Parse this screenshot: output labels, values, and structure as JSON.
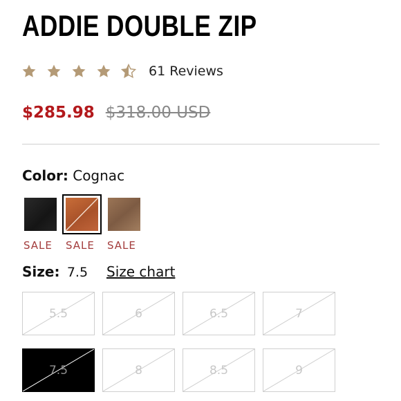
{
  "product": {
    "title": "ADDIE DOUBLE ZIP",
    "rating": 4.5,
    "reviews": "61 Reviews",
    "sale_price": "$285.98",
    "original_price": "$318.00 USD"
  },
  "color": {
    "label": "Color:",
    "selected": "Cognac",
    "swatches": [
      {
        "name": "Black",
        "sale": "SALE"
      },
      {
        "name": "Cognac",
        "sale": "SALE"
      },
      {
        "name": "Taupe",
        "sale": "SALE"
      }
    ]
  },
  "size": {
    "label": "Size:",
    "selected": "7.5",
    "chart_link": "Size chart",
    "options": [
      "5.5",
      "6",
      "6.5",
      "7",
      "7.5",
      "8",
      "8.5",
      "9"
    ]
  },
  "colors": {
    "sale_price": "#b3191c",
    "sale_tag": "#a33c3c",
    "star": "#b49a76"
  }
}
